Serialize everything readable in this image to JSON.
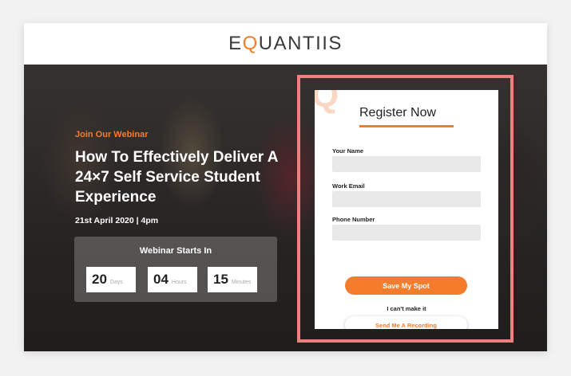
{
  "header": {
    "logo_pre": "E",
    "logo_q": "Q",
    "logo_post": "UANTIIS"
  },
  "hero": {
    "kicker": "Join Our Webinar",
    "title": "How To Effectively Deliver A 24×7 Self Service Student Experience",
    "date": "21st April 2020  |  4pm",
    "countdown": {
      "title": "Webinar Starts In",
      "days": {
        "value": "20",
        "unit": "Days"
      },
      "hours": {
        "value": "04",
        "unit": "Hours"
      },
      "minutes": {
        "value": "15",
        "unit": "Minutes"
      }
    }
  },
  "form": {
    "decor_letter": "Q",
    "title": "Register Now",
    "name_label": "Your Name",
    "email_label": "Work Email",
    "phone_label": "Phone Number",
    "submit_label": "Save My Spot",
    "cant_make_it": "I can't make it",
    "recording_label": "Send Me A Recording"
  },
  "colors": {
    "accent": "#f47c2a",
    "highlight": "#f08080"
  }
}
